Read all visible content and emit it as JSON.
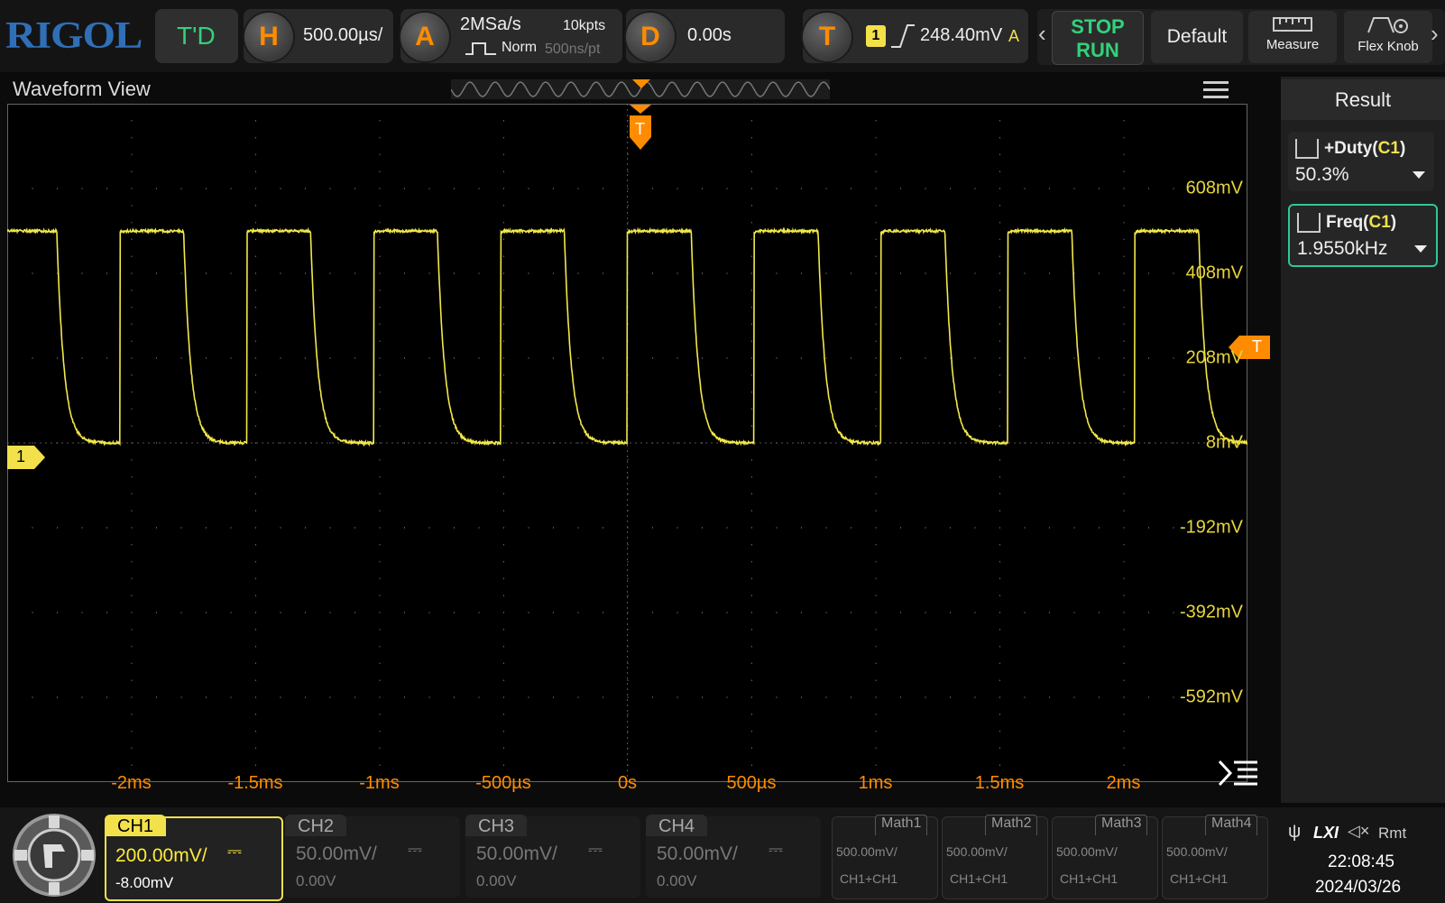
{
  "brand": "RIGOL",
  "toolbar": {
    "mode": "T'D",
    "h_letter": "H",
    "timebase": "500.00µs/",
    "a_letter": "A",
    "sample_rate": "2MSa/s",
    "memory_depth": "10kpts",
    "acq_mode": "Norm",
    "time_per_pt": "500ns/pt",
    "d_letter": "D",
    "delay": "0.00s",
    "t_letter": "T",
    "trig_source": "1",
    "trig_level": "248.40mV",
    "trig_sweep": "A",
    "stop_label": "STOP",
    "run_label": "RUN",
    "default_label": "Default",
    "measure_label": "Measure",
    "flexknob_label": "Flex Knob"
  },
  "waveform_view": {
    "title": "Waveform View",
    "trigger_marker": "T",
    "ch1_marker": "1",
    "x_labels": [
      "-2ms",
      "-1.5ms",
      "-1ms",
      "-500µs",
      "0s",
      "500µs",
      "1ms",
      "1.5ms",
      "2ms"
    ],
    "y_labels": [
      "608mV",
      "408mV",
      "208mV",
      "8mV",
      "-192mV",
      "-392mV",
      "-592mV"
    ]
  },
  "chart_data": {
    "type": "line",
    "x_unit": "s",
    "xlim": [
      -0.0025,
      0.0025
    ],
    "ylim_mV": [
      -792,
      808
    ],
    "trigger_level_mV": 248.4,
    "series": [
      {
        "name": "CH1",
        "color": "#f2e84a",
        "frequency_Hz": 1955.0,
        "duty_pct": 50.3,
        "high_mV": 508,
        "low_mV": 8
      }
    ]
  },
  "result": {
    "title": "Result",
    "items": [
      {
        "label": "+Duty(",
        "src": "C1",
        "end": ")",
        "value": "50.3%"
      },
      {
        "label": "Freq(",
        "src": "C1",
        "end": ")",
        "value": "1.9550kHz"
      }
    ]
  },
  "channels": [
    {
      "name": "CH1",
      "scale": "200.00mV/",
      "offset": "-8.00mV",
      "active": true,
      "color": "#ffeb3b"
    },
    {
      "name": "CH2",
      "scale": "50.00mV/",
      "offset": "0.00V",
      "active": false
    },
    {
      "name": "CH3",
      "scale": "50.00mV/",
      "offset": "0.00V",
      "active": false
    },
    {
      "name": "CH4",
      "scale": "50.00mV/",
      "offset": "0.00V",
      "active": false
    }
  ],
  "maths": [
    {
      "name": "Math1",
      "scale": "500.00mV/",
      "expr": "CH1+CH1"
    },
    {
      "name": "Math2",
      "scale": "500.00mV/",
      "expr": "CH1+CH1"
    },
    {
      "name": "Math3",
      "scale": "500.00mV/",
      "expr": "CH1+CH1"
    },
    {
      "name": "Math4",
      "scale": "500.00mV/",
      "expr": "CH1+CH1"
    }
  ],
  "status": {
    "icons": "usb-icon lxi-icon sound-icon",
    "lxi": "LXI",
    "rmt": "Rmt",
    "time": "22:08:45",
    "date": "2024/03/26"
  }
}
